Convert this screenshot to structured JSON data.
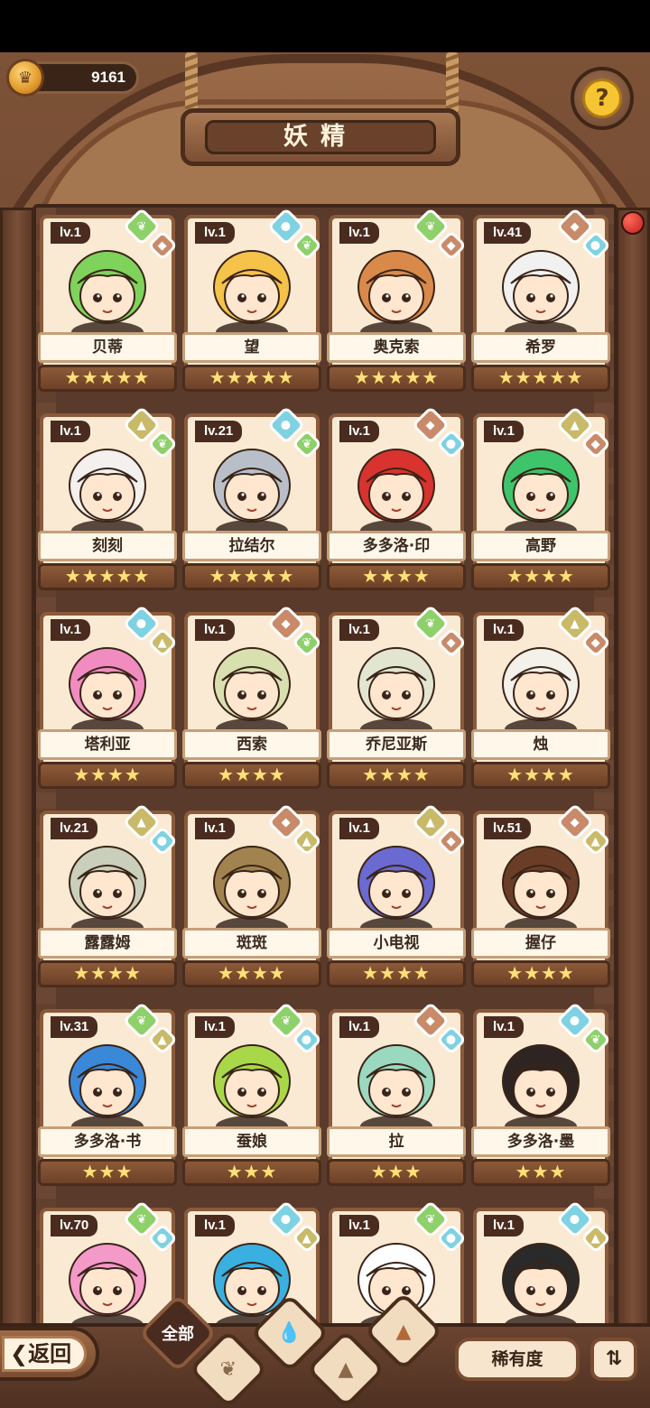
{
  "header": {
    "coins": "9161",
    "title": "妖精"
  },
  "colors": {
    "wood_dark": "#4b2d1c",
    "wood": "#7a4c30",
    "card_bg": "#fbead3",
    "star": "#ffe07a",
    "leaf": "#8ed06a",
    "water": "#7ed2e2",
    "earth": "#c9ba6a",
    "fire": "#c98a6a"
  },
  "cards": [
    {
      "level": "lv.1",
      "name": "贝蒂",
      "stars": "★★★★★",
      "star_count": 5,
      "elements": [
        "leaf",
        "fire"
      ],
      "hair": "#7fd35a"
    },
    {
      "level": "lv.1",
      "name": "望",
      "stars": "★★★★★",
      "star_count": 5,
      "elements": [
        "water",
        "leaf"
      ],
      "hair": "#f5c24a"
    },
    {
      "level": "lv.1",
      "name": "奥克索",
      "stars": "★★★★★",
      "star_count": 5,
      "elements": [
        "leaf",
        "fire"
      ],
      "hair": "#d98a4a"
    },
    {
      "level": "lv.41",
      "name": "希罗",
      "stars": "★★★★★",
      "star_count": 5,
      "elements": [
        "fire",
        "water"
      ],
      "hair": "#f1f1f1"
    },
    {
      "level": "lv.1",
      "name": "刻刻",
      "stars": "★★★★★",
      "star_count": 5,
      "elements": [
        "earth",
        "leaf"
      ],
      "hair": "#f4f0ee"
    },
    {
      "level": "lv.21",
      "name": "拉结尔",
      "stars": "★★★★★",
      "star_count": 5,
      "elements": [
        "water",
        "leaf"
      ],
      "hair": "#b9bfc9"
    },
    {
      "level": "lv.1",
      "name": "多多洛·印",
      "stars": "★★★★",
      "star_count": 4,
      "elements": [
        "fire",
        "water"
      ],
      "hair": "#d8332e"
    },
    {
      "level": "lv.1",
      "name": "高野",
      "stars": "★★★★",
      "star_count": 4,
      "elements": [
        "earth",
        "fire"
      ],
      "hair": "#3ec46a"
    },
    {
      "level": "lv.1",
      "name": "塔利亚",
      "stars": "★★★★",
      "star_count": 4,
      "elements": [
        "water",
        "earth"
      ],
      "hair": "#f08cc0"
    },
    {
      "level": "lv.1",
      "name": "西索",
      "stars": "★★★★",
      "star_count": 4,
      "elements": [
        "fire",
        "leaf"
      ],
      "hair": "#d9e0b0"
    },
    {
      "level": "lv.1",
      "name": "乔尼亚斯",
      "stars": "★★★★",
      "star_count": 4,
      "elements": [
        "leaf",
        "fire"
      ],
      "hair": "#e2e5d0"
    },
    {
      "level": "lv.1",
      "name": "烛",
      "stars": "★★★★",
      "star_count": 4,
      "elements": [
        "earth",
        "fire"
      ],
      "hair": "#f4f0ea"
    },
    {
      "level": "lv.21",
      "name": "露露姆",
      "stars": "★★★★",
      "star_count": 4,
      "elements": [
        "earth",
        "water"
      ],
      "hair": "#c9cfba"
    },
    {
      "level": "lv.1",
      "name": "斑斑",
      "stars": "★★★★",
      "star_count": 4,
      "elements": [
        "fire",
        "earth"
      ],
      "hair": "#a0834e"
    },
    {
      "level": "lv.1",
      "name": "小电视",
      "stars": "★★★★",
      "star_count": 4,
      "elements": [
        "earth",
        "fire"
      ],
      "hair": "#6a6ad0"
    },
    {
      "level": "lv.51",
      "name": "握仔",
      "stars": "★★★★",
      "star_count": 4,
      "elements": [
        "fire",
        "earth"
      ],
      "hair": "#6a3e26"
    },
    {
      "level": "lv.31",
      "name": "多多洛·书",
      "stars": "★★★",
      "star_count": 3,
      "elements": [
        "leaf",
        "earth"
      ],
      "hair": "#3a88d8"
    },
    {
      "level": "lv.1",
      "name": "蚕娘",
      "stars": "★★★",
      "star_count": 3,
      "elements": [
        "leaf",
        "water"
      ],
      "hair": "#a8d84a"
    },
    {
      "level": "lv.1",
      "name": "拉",
      "stars": "★★★",
      "star_count": 3,
      "elements": [
        "fire",
        "water"
      ],
      "hair": "#9ad8c0"
    },
    {
      "level": "lv.1",
      "name": "多多洛·墨",
      "stars": "★★★",
      "star_count": 3,
      "elements": [
        "water",
        "leaf"
      ],
      "hair": "#2e2422"
    },
    {
      "level": "lv.70",
      "name": "",
      "stars": "",
      "star_count": 0,
      "elements": [
        "leaf",
        "water"
      ],
      "hair": "#f39ac8"
    },
    {
      "level": "lv.1",
      "name": "",
      "stars": "",
      "star_count": 0,
      "elements": [
        "water",
        "earth"
      ],
      "hair": "#3ab0e0"
    },
    {
      "level": "lv.1",
      "name": "",
      "stars": "",
      "star_count": 0,
      "elements": [
        "leaf",
        "water"
      ],
      "hair": "#ffffff"
    },
    {
      "level": "lv.1",
      "name": "",
      "stars": "",
      "star_count": 0,
      "elements": [
        "water",
        "earth"
      ],
      "hair": "#2a2a2a"
    }
  ],
  "bottom": {
    "back_label": "返回",
    "back_icon": "chevron-left-icon",
    "filters": [
      {
        "label": "全部",
        "icon": ""
      },
      {
        "label": "",
        "icon": "leaf-icon"
      },
      {
        "label": "",
        "icon": "water-drop-icon"
      },
      {
        "label": "",
        "icon": "mountain-icon"
      },
      {
        "label": "",
        "icon": "fire-icon"
      }
    ],
    "rarity_label": "稀有度",
    "sort_icon": "sort-icon"
  }
}
